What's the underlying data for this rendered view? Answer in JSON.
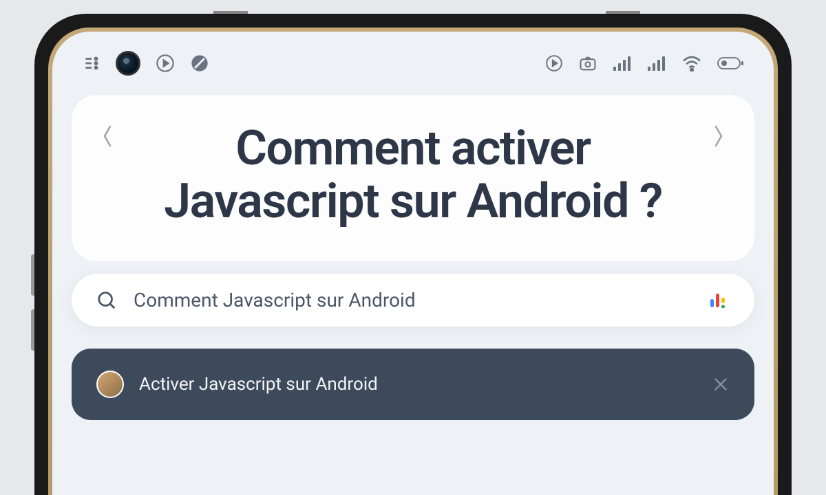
{
  "page": {
    "title": "Comment activer Javascript sur Android ?"
  },
  "search": {
    "value": "Comment Javascript sur Android"
  },
  "result": {
    "title": "Activer Javascript sur Android"
  }
}
